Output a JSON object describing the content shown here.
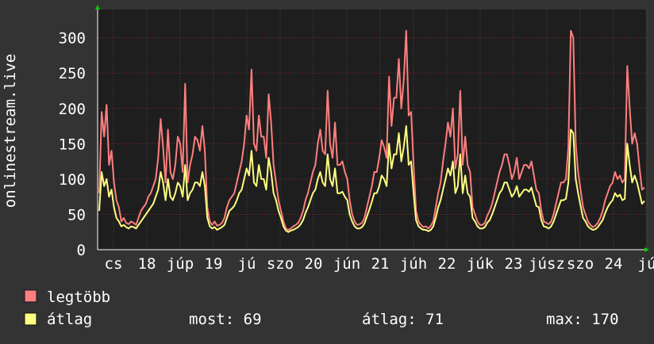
{
  "chart_data": {
    "type": "line",
    "ylabel": "onlinestream.live",
    "ylim": [
      0,
      340
    ],
    "y_ticks": [
      "0",
      "50",
      "100",
      "150",
      "200",
      "250",
      "300"
    ],
    "x_ticks": [
      "cs",
      "18",
      "júp",
      "19",
      "jú",
      "szo",
      "20",
      "jún",
      "21",
      "júh",
      "22",
      "júk",
      "23",
      "júsz",
      "szo",
      "24",
      "jú"
    ],
    "grid": true,
    "legend_placement": "bottom-left",
    "series": [
      {
        "name": "legtöbb",
        "color": "#ff7f7f",
        "values": [
          80,
          195,
          160,
          205,
          120,
          140,
          95,
          70,
          60,
          40,
          45,
          38,
          36,
          40,
          38,
          35,
          45,
          55,
          60,
          65,
          75,
          80,
          90,
          100,
          130,
          185,
          145,
          95,
          170,
          110,
          100,
          120,
          160,
          150,
          110,
          235,
          95,
          120,
          135,
          160,
          155,
          140,
          175,
          140,
          60,
          40,
          35,
          40,
          34,
          35,
          38,
          45,
          60,
          70,
          75,
          80,
          95,
          110,
          125,
          150,
          190,
          170,
          255,
          150,
          140,
          190,
          160,
          160,
          130,
          220,
          180,
          120,
          95,
          70,
          55,
          40,
          30,
          28,
          30,
          33,
          35,
          38,
          45,
          55,
          70,
          80,
          95,
          110,
          120,
          150,
          170,
          140,
          135,
          225,
          150,
          130,
          180,
          120,
          120,
          125,
          110,
          100,
          70,
          50,
          40,
          35,
          36,
          38,
          45,
          60,
          75,
          90,
          110,
          110,
          130,
          155,
          145,
          130,
          245,
          175,
          215,
          215,
          270,
          200,
          240,
          310,
          190,
          195,
          120,
          55,
          40,
          35,
          32,
          33,
          30,
          34,
          40,
          60,
          80,
          95,
          125,
          150,
          180,
          160,
          200,
          115,
          135,
          225,
          120,
          160,
          120,
          110,
          60,
          50,
          40,
          35,
          35,
          38,
          48,
          55,
          65,
          80,
          95,
          110,
          120,
          135,
          135,
          120,
          100,
          110,
          130,
          100,
          110,
          120,
          120,
          115,
          125,
          105,
          85,
          80,
          55,
          40,
          38,
          36,
          40,
          50,
          65,
          80,
          95,
          95,
          100,
          145,
          310,
          300,
          150,
          110,
          85,
          60,
          50,
          40,
          35,
          32,
          34,
          38,
          45,
          55,
          70,
          80,
          90,
          95,
          110,
          100,
          105,
          95,
          100,
          260,
          200,
          150,
          165,
          150,
          115,
          85,
          88
        ]
      },
      {
        "name": "átlag",
        "color": "#ffff80",
        "values": [
          55,
          110,
          90,
          100,
          75,
          85,
          60,
          45,
          40,
          33,
          35,
          32,
          30,
          33,
          32,
          30,
          35,
          40,
          45,
          50,
          55,
          60,
          65,
          75,
          85,
          110,
          95,
          70,
          100,
          75,
          70,
          80,
          95,
          90,
          75,
          120,
          70,
          80,
          85,
          95,
          95,
          90,
          110,
          90,
          45,
          33,
          30,
          32,
          28,
          30,
          32,
          35,
          45,
          55,
          58,
          62,
          70,
          80,
          85,
          100,
          115,
          105,
          140,
          95,
          90,
          120,
          100,
          100,
          85,
          130,
          110,
          80,
          70,
          55,
          45,
          33,
          27,
          25,
          27,
          28,
          30,
          32,
          36,
          42,
          52,
          60,
          70,
          80,
          85,
          100,
          110,
          95,
          90,
          135,
          100,
          90,
          115,
          80,
          80,
          82,
          75,
          70,
          50,
          40,
          33,
          30,
          30,
          32,
          37,
          47,
          57,
          68,
          80,
          80,
          90,
          105,
          100,
          90,
          150,
          115,
          135,
          135,
          165,
          125,
          145,
          175,
          120,
          125,
          80,
          42,
          33,
          30,
          28,
          28,
          26,
          28,
          33,
          45,
          60,
          70,
          85,
          100,
          115,
          105,
          125,
          80,
          90,
          135,
          80,
          105,
          80,
          75,
          45,
          40,
          33,
          30,
          30,
          32,
          38,
          42,
          50,
          60,
          70,
          80,
          85,
          95,
          95,
          85,
          75,
          80,
          90,
          75,
          80,
          85,
          85,
          82,
          88,
          75,
          62,
          60,
          42,
          33,
          32,
          30,
          33,
          40,
          50,
          60,
          70,
          70,
          72,
          95,
          170,
          165,
          100,
          80,
          62,
          45,
          40,
          33,
          30,
          28,
          29,
          32,
          37,
          42,
          52,
          60,
          66,
          70,
          80,
          75,
          78,
          70,
          72,
          150,
          120,
          95,
          105,
          95,
          80,
          65,
          69
        ]
      }
    ]
  },
  "legend": {
    "max_label": "legtöbb",
    "avg_label": "átlag",
    "stats": {
      "now": "most: 69",
      "avg": "átlag: 71",
      "max": "max: 170"
    }
  },
  "colors": {
    "background": "#333333",
    "plot_background": "#1e1e1e",
    "max_series": "#ff7f7f",
    "avg_series": "#ffff80",
    "grid": "#8a2a2a",
    "arrow": "#00cc00"
  }
}
